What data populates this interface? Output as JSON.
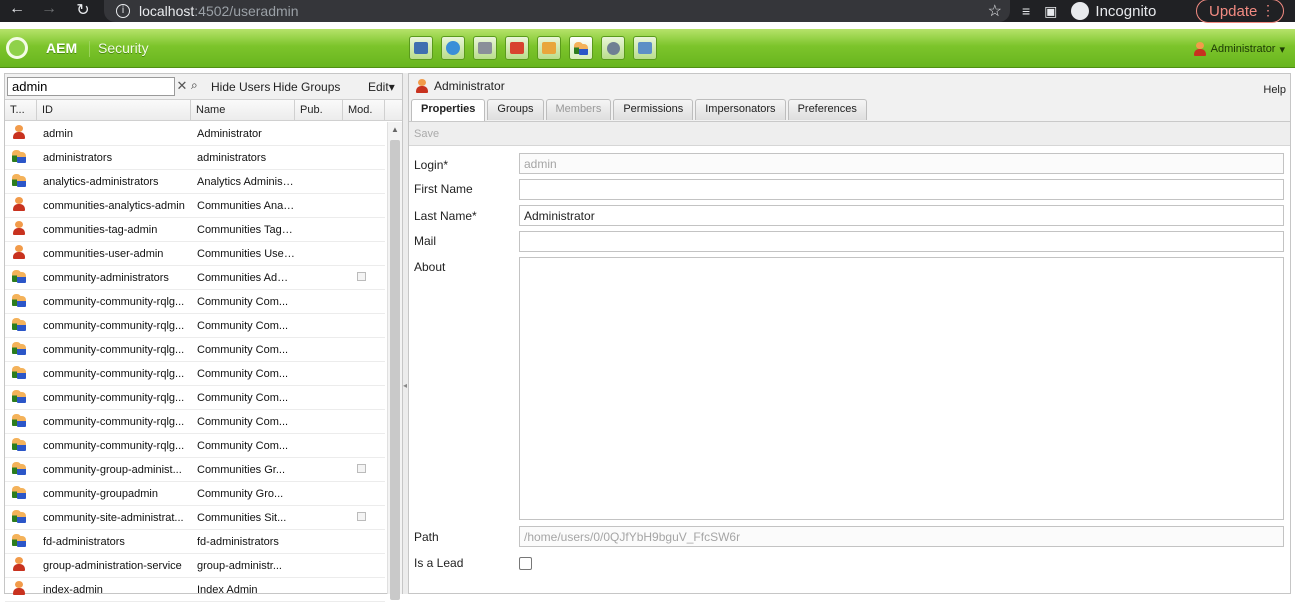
{
  "browser": {
    "url_host": "localhost",
    "url_path": ":4502/useradmin",
    "incognito_label": "Incognito",
    "update_label": "Update"
  },
  "aem": {
    "brand": "AEM",
    "section": "Security",
    "user_menu": "Administrator",
    "toolbar_icons": [
      "network-icon",
      "globe-icon",
      "camera-icon",
      "megaphone-icon",
      "mail-icon",
      "users-icon",
      "gears-icon",
      "tags-icon"
    ]
  },
  "left": {
    "search_value": "admin",
    "hide_users": "Hide Users",
    "hide_groups": "Hide Groups",
    "edit": "Edit",
    "columns": [
      "T...",
      "ID",
      "Name",
      "Pub.",
      "Mod."
    ],
    "rows": [
      {
        "type": "user",
        "id": "admin",
        "name": "Administrator",
        "mod": false
      },
      {
        "type": "group",
        "id": "administrators",
        "name": "administrators",
        "mod": false
      },
      {
        "type": "group",
        "id": "analytics-administrators",
        "name": "Analytics Administrators",
        "mod": false
      },
      {
        "type": "user",
        "id": "communities-analytics-admin",
        "name": "Communities Analytics Admin",
        "mod": false
      },
      {
        "type": "user",
        "id": "communities-tag-admin",
        "name": "Communities Tag Admin",
        "mod": false
      },
      {
        "type": "user",
        "id": "communities-user-admin",
        "name": "Communities User Admin",
        "mod": false
      },
      {
        "type": "group",
        "id": "community-administrators",
        "name": "Communities Administrators",
        "mod": true
      },
      {
        "type": "group",
        "id": "community-community-rqlg...",
        "name": "Community Com...",
        "mod": false
      },
      {
        "type": "group",
        "id": "community-community-rqlg...",
        "name": "Community Com...",
        "mod": false
      },
      {
        "type": "group",
        "id": "community-community-rqlg...",
        "name": "Community Com...",
        "mod": false
      },
      {
        "type": "group",
        "id": "community-community-rqlg...",
        "name": "Community Com...",
        "mod": false
      },
      {
        "type": "group",
        "id": "community-community-rqlg...",
        "name": "Community Com...",
        "mod": false
      },
      {
        "type": "group",
        "id": "community-community-rqlg...",
        "name": "Community Com...",
        "mod": false
      },
      {
        "type": "group",
        "id": "community-community-rqlg...",
        "name": "Community Com...",
        "mod": false
      },
      {
        "type": "group",
        "id": "community-group-administ...",
        "name": "Communities Gr...",
        "mod": true
      },
      {
        "type": "group",
        "id": "community-groupadmin",
        "name": "Community Gro...",
        "mod": false
      },
      {
        "type": "group",
        "id": "community-site-administrat...",
        "name": "Communities Sit...",
        "mod": true
      },
      {
        "type": "group",
        "id": "fd-administrators",
        "name": "fd-administrators",
        "mod": false
      },
      {
        "type": "user",
        "id": "group-administration-service",
        "name": "group-administr...",
        "mod": false
      },
      {
        "type": "user",
        "id": "index-admin",
        "name": "Index Admin",
        "mod": false
      }
    ]
  },
  "right": {
    "title": "Administrator",
    "help": "Help",
    "tabs": [
      "Properties",
      "Groups",
      "Members",
      "Permissions",
      "Impersonators",
      "Preferences"
    ],
    "save": "Save",
    "labels": {
      "login": "Login*",
      "first_name": "First Name",
      "last_name": "Last Name*",
      "mail": "Mail",
      "about": "About",
      "path": "Path",
      "is_lead": "Is a Lead"
    },
    "values": {
      "login": "admin",
      "first_name": "",
      "last_name": "Administrator",
      "mail": "",
      "about": "",
      "path": "/home/users/0/0QJfYbH9bguV_FfcSW6r",
      "is_lead": false
    }
  }
}
